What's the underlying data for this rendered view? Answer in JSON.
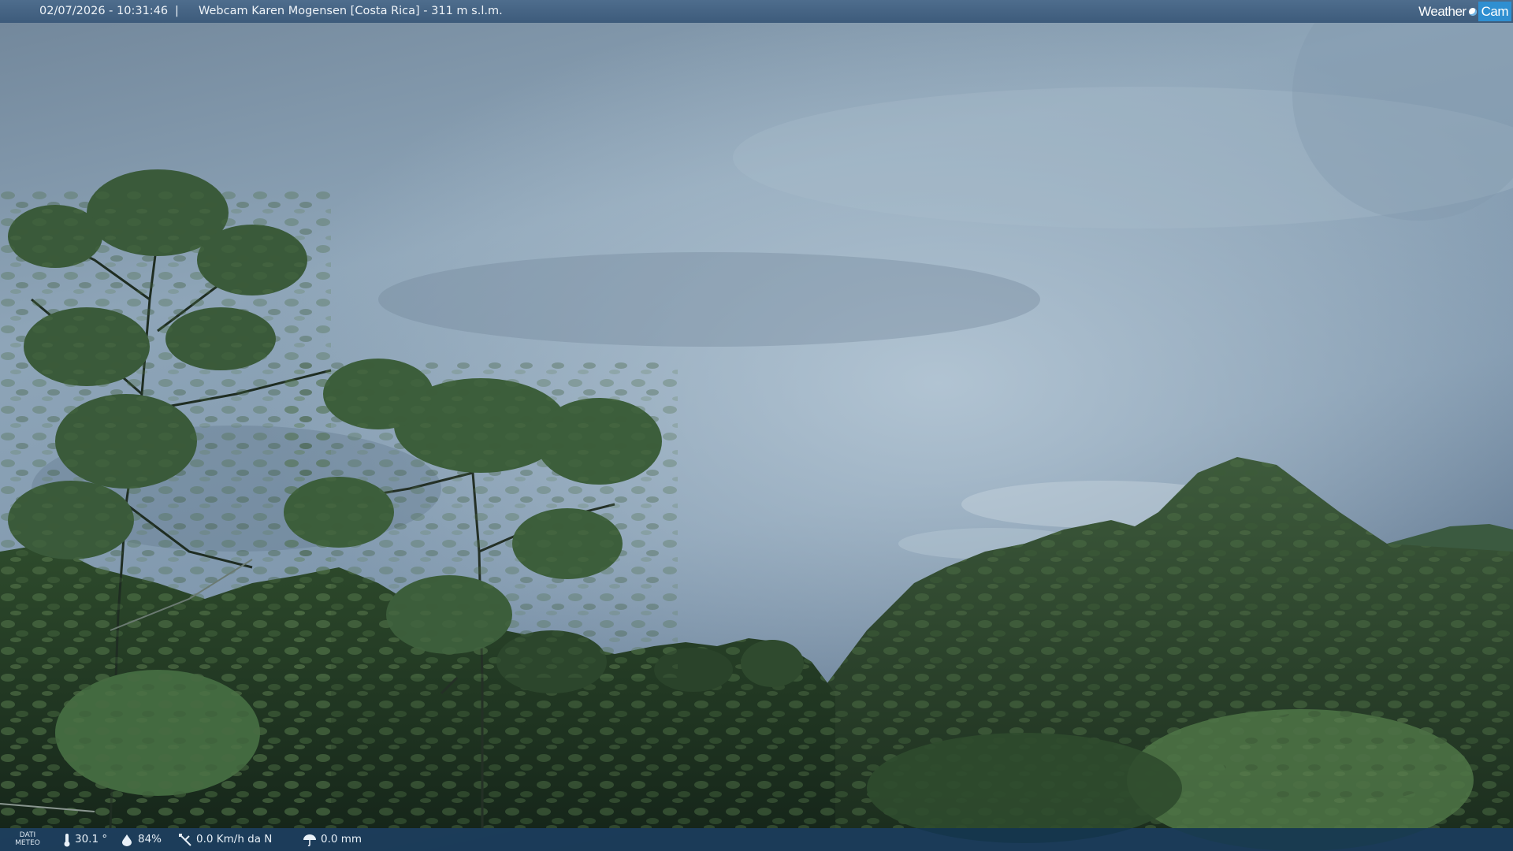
{
  "header": {
    "datetime": "02/07/2026 - 10:31:46",
    "separator": "|",
    "caption": "Webcam Karen Mogensen [Costa Rica] - 311 m s.l.m."
  },
  "logo": {
    "word_weather": "Weather",
    "word_cam": "Cam",
    "accent_color": "#2f8fd1"
  },
  "weather_bar": {
    "label_line1": "DATI",
    "label_line2": "METEO",
    "temperature": "30.1 °",
    "humidity": "84%",
    "wind": "0.0 Km/h da N",
    "rain": "0.0 mm",
    "icons": [
      "thermometer-icon",
      "humidity-icon",
      "wind-icon",
      "rain-gauge-icon"
    ]
  }
}
